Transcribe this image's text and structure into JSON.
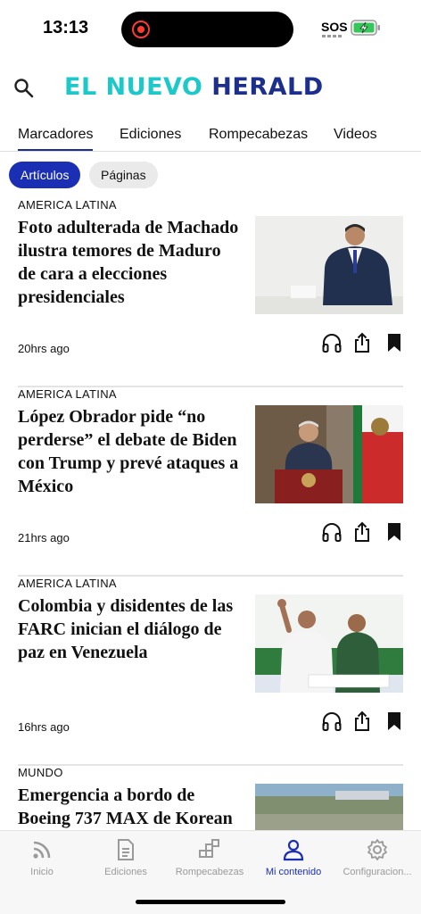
{
  "status_bar": {
    "time": "13:13",
    "sos": "SOS",
    "recording_color": "#ff3b30"
  },
  "header": {
    "logo_part1": "EL NUEVO ",
    "logo_part2": "HERALD",
    "logo_colors": [
      "#1dc8c9",
      "#1d2f8c"
    ],
    "search_icon": "search-icon"
  },
  "tabs": [
    {
      "label": "Marcadores",
      "active": true
    },
    {
      "label": "Ediciones",
      "active": false
    },
    {
      "label": "Rompecabezas",
      "active": false
    },
    {
      "label": "Videos",
      "active": false
    }
  ],
  "filters": [
    {
      "label": "Artículos",
      "active": true
    },
    {
      "label": "Páginas",
      "active": false
    }
  ],
  "articles": [
    {
      "section": "AMERICA LATINA",
      "headline": "Foto adulterada de Machado ilustra temores de Maduro de cara a elecciones presidenciales",
      "time": "20hrs ago"
    },
    {
      "section": "AMERICA LATINA",
      "headline": "López Obrador pide “no perderse” el debate de Biden con Trump y prevé ataques a México",
      "time": "21hrs ago"
    },
    {
      "section": "AMERICA LATINA",
      "headline": "Colombia y disidentes de las FARC inician el diálogo de paz en Venezuela",
      "time": "16hrs ago"
    },
    {
      "section": "MUNDO",
      "headline": "Emergencia a bordo de Boeing 737 MAX de Korean",
      "time": ""
    }
  ],
  "bottom_nav": [
    {
      "label": "Inicio",
      "icon": "rss-icon",
      "active": false
    },
    {
      "label": "Ediciones",
      "icon": "document-icon",
      "active": false
    },
    {
      "label": "Rompecabezas",
      "icon": "puzzle-icon",
      "active": false
    },
    {
      "label": "Mi contenido",
      "icon": "person-icon",
      "active": true
    },
    {
      "label": "Configuracion...",
      "icon": "gear-icon",
      "active": false
    }
  ],
  "accent_color": "#1b2fb5"
}
